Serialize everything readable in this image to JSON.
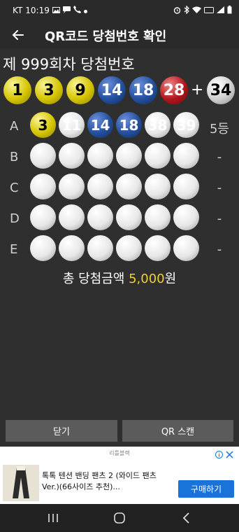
{
  "status": {
    "carrier": "KT",
    "time": "10:19",
    "icons": [
      "gallery-icon",
      "message-icon",
      "call-icon",
      "dot-icon",
      "alarm-icon",
      "bluetooth-icon",
      "wifi-icon",
      "volte-icon",
      "signal-icon",
      "battery-icon"
    ]
  },
  "appbar": {
    "title": "QR코드 당첨번호 확인"
  },
  "round": {
    "title": "제 999회차 당첨번호"
  },
  "winning": {
    "numbers": [
      "1",
      "3",
      "9",
      "14",
      "18",
      "28"
    ],
    "colors": [
      "yellow",
      "yellow",
      "yellow",
      "blue",
      "blue",
      "red"
    ],
    "plus": "+",
    "bonus": "34",
    "bonus_color": "gray"
  },
  "games": [
    {
      "label": "A",
      "numbers": [
        "3",
        "11",
        "14",
        "18",
        "38",
        "39"
      ],
      "styles": [
        "yellow",
        "white",
        "blue",
        "blue",
        "white",
        "white"
      ],
      "rank": "5등"
    },
    {
      "label": "B",
      "numbers": [
        "",
        "",
        "",
        "",
        "",
        ""
      ],
      "styles": [
        "white",
        "white",
        "white",
        "white",
        "white",
        "white"
      ],
      "rank": "-"
    },
    {
      "label": "C",
      "numbers": [
        "",
        "",
        "",
        "",
        "",
        ""
      ],
      "styles": [
        "white",
        "white",
        "white",
        "white",
        "white",
        "white"
      ],
      "rank": "-"
    },
    {
      "label": "D",
      "numbers": [
        "",
        "",
        "",
        "",
        "",
        ""
      ],
      "styles": [
        "white",
        "white",
        "white",
        "white",
        "white",
        "white"
      ],
      "rank": "-"
    },
    {
      "label": "E",
      "numbers": [
        "",
        "",
        "",
        "",
        "",
        ""
      ],
      "styles": [
        "white",
        "white",
        "white",
        "white",
        "white",
        "white"
      ],
      "rank": "-"
    }
  ],
  "total": {
    "prefix": "총 당첨금액 ",
    "amount": "5,000",
    "suffix": "원",
    "amount_color": "#f1d12d"
  },
  "buttons": {
    "close": "닫기",
    "scan": "QR 스캔"
  },
  "ad": {
    "label": "리틀블랙",
    "text": "톡톡 텐션 밴딩 팬츠 2 (와이드 팬츠 Ver.)(66사이즈 추천)...",
    "buy": "구매하기",
    "button_color": "#1a73d9"
  },
  "navbar": {
    "icons": [
      "recent-apps-icon",
      "home-icon",
      "back-nav-icon"
    ]
  }
}
